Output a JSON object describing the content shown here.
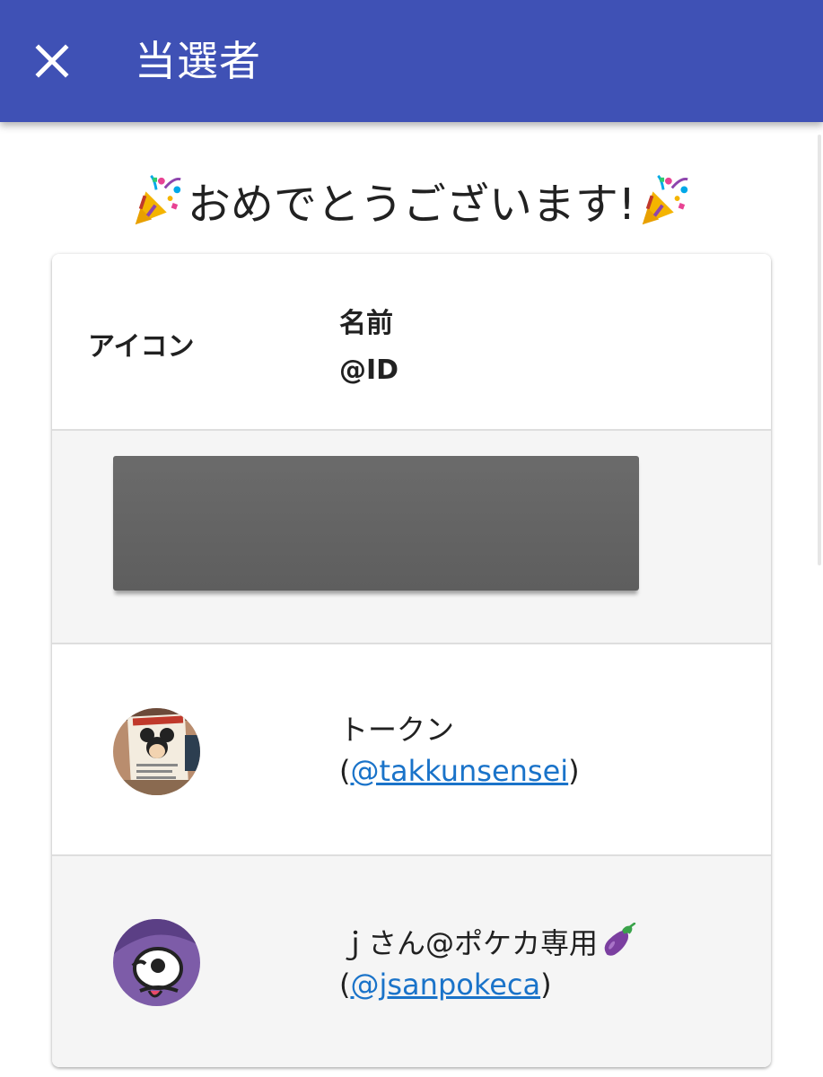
{
  "appbar": {
    "title": "当選者",
    "close_icon": "close-icon",
    "color": "#3f51b5"
  },
  "congrats": {
    "text": "おめでとうございます!",
    "icon": "party-popper-icon"
  },
  "table": {
    "headers": {
      "icon": "アイコン",
      "name": "名前",
      "id": "@ID"
    },
    "rows": [
      {
        "redacted": true
      },
      {
        "name": "トークン",
        "open_paren": "(",
        "handle": "@takkunsensei",
        "close_paren": ")",
        "avatar": "avatar-photo"
      },
      {
        "name": "ｊさん@ポケカ専用",
        "name_icon": "eggplant-icon",
        "open_paren": "(",
        "handle": "@jsanpokeca",
        "close_paren": ")",
        "avatar": "avatar-cartoon"
      }
    ]
  },
  "colors": {
    "link": "#1a73c9",
    "row_alt": "#f5f5f5"
  }
}
